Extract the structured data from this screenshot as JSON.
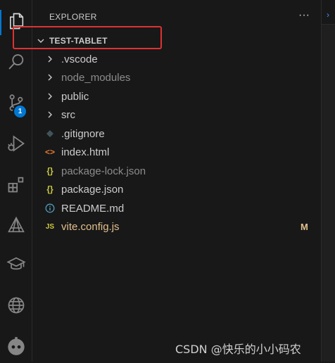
{
  "sidebar": {
    "title": "EXPLORER",
    "more_actions": "···",
    "root_folder": "TEST-TABLET"
  },
  "activity_bar": {
    "items": [
      {
        "name": "explorer",
        "icon": "files-icon",
        "active": true
      },
      {
        "name": "search",
        "icon": "search-icon"
      },
      {
        "name": "source-control",
        "icon": "source-control-icon",
        "badge": "1"
      },
      {
        "name": "run-and-debug",
        "icon": "run-debug-icon"
      },
      {
        "name": "extensions",
        "icon": "extensions-icon"
      },
      {
        "name": "remote-explorer",
        "icon": "triangle-icon"
      },
      {
        "name": "learn",
        "icon": "graduation-cap-icon"
      },
      {
        "name": "web",
        "icon": "globe-icon"
      },
      {
        "name": "assistant",
        "icon": "robot-icon"
      }
    ]
  },
  "tree": {
    "items": [
      {
        "label": ".vscode",
        "type": "folder",
        "icon": "chevron-right-icon",
        "color": "#cccccc"
      },
      {
        "label": "node_modules",
        "type": "folder",
        "icon": "chevron-right-icon",
        "color": "#8c8c8c"
      },
      {
        "label": "public",
        "type": "folder",
        "icon": "chevron-right-icon",
        "color": "#cccccc"
      },
      {
        "label": "src",
        "type": "folder",
        "icon": "chevron-right-icon",
        "color": "#cccccc"
      },
      {
        "label": ".gitignore",
        "type": "file",
        "icon": "git-diamond-icon",
        "color": "#cccccc"
      },
      {
        "label": "index.html",
        "type": "file",
        "icon": "html-icon",
        "color": "#cccccc"
      },
      {
        "label": "package-lock.json",
        "type": "file",
        "icon": "json-braces-icon",
        "color": "#8c8c8c"
      },
      {
        "label": "package.json",
        "type": "file",
        "icon": "json-braces-icon",
        "color": "#cccccc"
      },
      {
        "label": "README.md",
        "type": "file",
        "icon": "info-icon",
        "color": "#cccccc"
      },
      {
        "label": "vite.config.js",
        "type": "file",
        "icon": "js-icon",
        "color": "#e2c08d",
        "status": "M"
      }
    ]
  },
  "icon_glyphs": {
    "chevron": "›",
    "html": "<>",
    "json": "{}",
    "info": "i",
    "js": "JS"
  },
  "watermark": "CSDN @快乐的小小码农"
}
